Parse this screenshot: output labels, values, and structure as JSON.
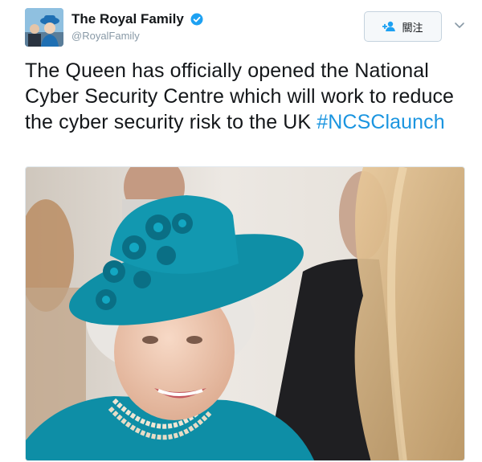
{
  "account": {
    "display_name": "The Royal Family",
    "handle": "@RoyalFamily",
    "verified": true,
    "avatar_icon": "royal-family-avatar-photo"
  },
  "follow_button": {
    "label": "關注",
    "icon": "add-user-icon"
  },
  "menu_icon": "chevron-down-icon",
  "tweet": {
    "text": "The Queen has officially opened the National Cyber Security Centre which will work to reduce the cyber security risk to the UK",
    "hashtag": "#NCSClaunch"
  },
  "media": {
    "type": "photo"
  },
  "colors": {
    "link": "#1b95e0",
    "verified_badge": "#1da1f2",
    "hat_teal": "#0f8fa6"
  }
}
